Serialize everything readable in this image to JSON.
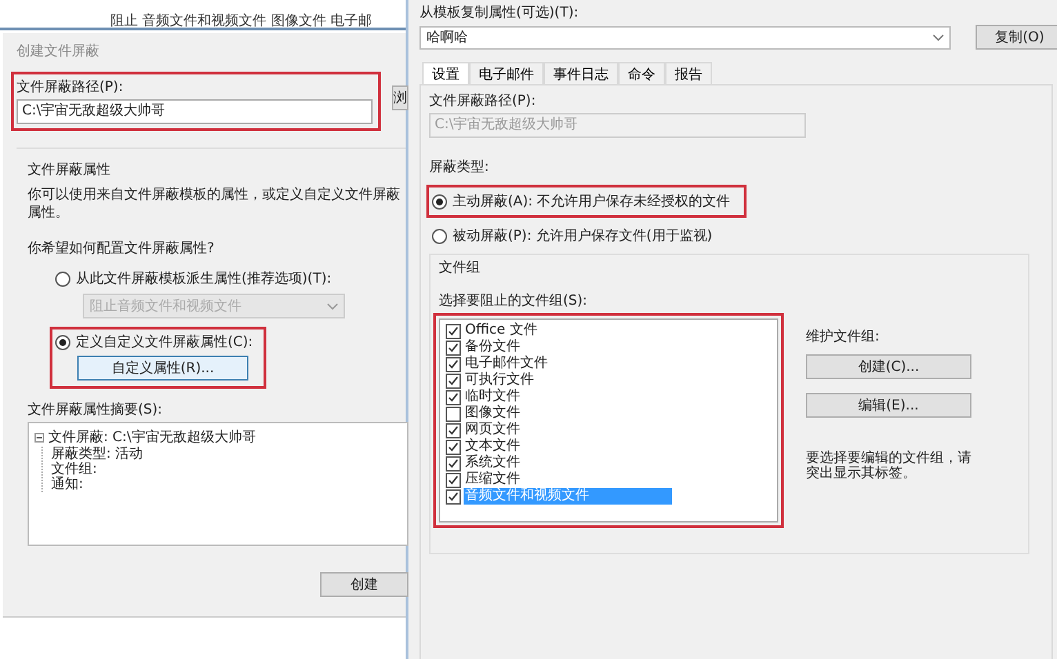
{
  "background_window": {
    "text": "阻止 音频文件和视频文件 图像文件 电子邮"
  },
  "create_dialog": {
    "title": "创建文件屏蔽",
    "path_label": "文件屏蔽路径(P):",
    "path_value": "C:\\宇宙无敌超级大帅哥",
    "browse_button": "浏",
    "section_title": "文件屏蔽属性",
    "description": "你可以使用来自文件屏蔽模板的属性，或定义自定义文件屏蔽属性。",
    "question": "你希望如何配置文件屏蔽属性?",
    "options": [
      {
        "label": "从此文件屏蔽模板派生属性(推荐选项)(T):",
        "selected": false,
        "kind": "template",
        "dropdown": {
          "value": "阻止音频文件和视频文件",
          "disabled": true
        }
      },
      {
        "label": "定义自定义文件屏蔽属性(C):",
        "selected": true,
        "kind": "custom",
        "button": "自定义属性(R)..."
      }
    ],
    "summary_label": "文件屏蔽属性摘要(S):",
    "summary_tree": [
      {
        "label": "文件屏蔽: C:\\宇宙无敌超级大帅哥",
        "expanded": true,
        "children": [
          {
            "label": "屏蔽类型: 活动"
          },
          {
            "label": "文件组:"
          },
          {
            "label": "通知:"
          }
        ]
      }
    ],
    "create_button": "创建"
  },
  "properties_dialog": {
    "template_label": "从模板复制属性(可选)(T):",
    "template_value": "哈啊哈",
    "copy_button": "复制(O)",
    "tabs": [
      {
        "label": "设置",
        "selected": true
      },
      {
        "label": "电子邮件",
        "selected": false
      },
      {
        "label": "事件日志",
        "selected": false
      },
      {
        "label": "命令",
        "selected": false
      },
      {
        "label": "报告",
        "selected": false
      }
    ],
    "path_label": "文件屏蔽路径(P):",
    "path_value": "C:\\宇宙无敌超级大帅哥",
    "screen_type_label": "屏蔽类型:",
    "screen_types": [
      {
        "label": "主动屏蔽(A): 不允许用户保存未经授权的文件",
        "selected": true
      },
      {
        "label": "被动屏蔽(P): 允许用户保存文件(用于监视)",
        "selected": false
      }
    ],
    "file_groups_title": "文件组",
    "file_groups_label": "选择要阻止的文件组(S):",
    "file_groups": [
      {
        "label": "Office 文件",
        "checked": true,
        "selected": false
      },
      {
        "label": "备份文件",
        "checked": true,
        "selected": false
      },
      {
        "label": "电子邮件文件",
        "checked": true,
        "selected": false
      },
      {
        "label": "可执行文件",
        "checked": true,
        "selected": false
      },
      {
        "label": "临时文件",
        "checked": true,
        "selected": false
      },
      {
        "label": "图像文件",
        "checked": false,
        "selected": false
      },
      {
        "label": "网页文件",
        "checked": true,
        "selected": false
      },
      {
        "label": "文本文件",
        "checked": true,
        "selected": false
      },
      {
        "label": "系统文件",
        "checked": true,
        "selected": false
      },
      {
        "label": "压缩文件",
        "checked": true,
        "selected": false
      },
      {
        "label": "音频文件和视频文件",
        "checked": true,
        "selected": true
      }
    ],
    "maintain_label": "维护文件组:",
    "create_group_button": "创建(C)...",
    "edit_group_button": "编辑(E)...",
    "hint": "要选择要编辑的文件组，请突出显示其标签。"
  }
}
